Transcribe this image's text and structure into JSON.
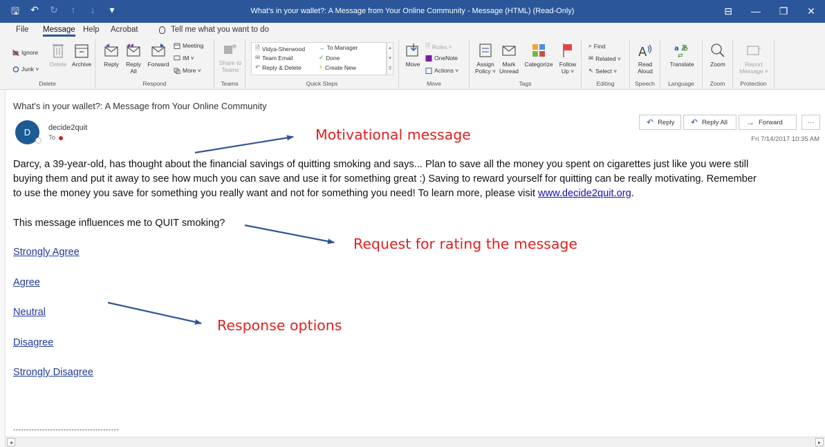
{
  "window": {
    "title": "What's in your wallet?: A Message from Your Online Community  -  Message (HTML) (Read-Only)",
    "controls": [
      "⊟",
      "—",
      "❐",
      "✕"
    ]
  },
  "qat": [
    "🖫",
    "↶",
    "↻",
    "↑",
    "↓",
    "▾"
  ],
  "menu": {
    "tabs": [
      "File",
      "Message",
      "Help",
      "Acrobat"
    ],
    "active_tab": "Message",
    "tell_me": "Tell me what you want to do"
  },
  "ribbon": {
    "delete_group": {
      "ignore": "Ignore",
      "junk": "Junk ˅",
      "delete": "Delete",
      "archive": "Archive",
      "label": "Delete"
    },
    "respond_group": {
      "reply": "Reply",
      "reply_all_1": "Reply",
      "reply_all_2": "All",
      "forward": "Forward",
      "meeting": "Meeting",
      "im": "IM ˅",
      "more": "More ˅",
      "label": "Respond"
    },
    "teams_group": {
      "share1": "Share to",
      "share2": "Teams",
      "label": "Teams"
    },
    "quick_steps": {
      "items": [
        "Vidya-Sherwood",
        "Team Email",
        "Reply & Delete",
        "To Manager",
        "Done",
        "Create New"
      ],
      "label": "Quick Steps"
    },
    "move_group": {
      "move": "Move",
      "rules": "Rules ˅",
      "onenote": "OneNote",
      "actions": "Actions ˅",
      "label": "Move"
    },
    "tags_group": {
      "assign1": "Assign",
      "assign2": "Policy ˅",
      "mark1": "Mark",
      "mark2": "Unread",
      "categorize": "Categorize",
      "follow1": "Follow",
      "follow2": "Up ˅",
      "label": "Tags"
    },
    "editing_group": {
      "find": "Find",
      "related": "Related ˅",
      "select": "Select ˅",
      "label": "Editing"
    },
    "speech_group": {
      "read1": "Read",
      "read2": "Aloud",
      "label": "Speech"
    },
    "language_group": {
      "translate": "Translate",
      "label": "Language"
    },
    "zoom_group": {
      "zoom": "Zoom",
      "label": "Zoom"
    },
    "protection_group": {
      "report1": "Report",
      "report2": "Message ˅",
      "label": "Protection"
    }
  },
  "message": {
    "subject": "What's in your wallet?: A Message from Your Online Community",
    "avatar_initial": "D",
    "sender": "decide2quit",
    "to_label": "To",
    "date": "Fri 7/14/2017 10:35 AM",
    "reply": "Reply",
    "reply_all": "Reply All",
    "forward": "Forward",
    "more": "···",
    "body_line1": "Darcy, a 39-year-old, has thought about the financial savings of quitting smoking and says... Plan to save all the money you spent on cigarettes just like you were still",
    "body_line2": "buying them and put it away to see how much you can save and use it for something great :) Saving to reward yourself for quitting can be really motivating. Remember",
    "body_line3": "to use the money you save for something you really want and not for something you need! To learn more, please visit ",
    "link": "www.decide2quit.org",
    "link_after": ".",
    "question": "This message influences me to QUIT smoking?",
    "options": [
      "Strongly Agree",
      "Agree",
      "Neutral",
      "Disagree",
      "Strongly Disagree"
    ],
    "footer_dashes": "----------------------------------------"
  },
  "annotations": {
    "motivational": "Motivational message",
    "request": "Request for rating the message",
    "responses": "Response options",
    "color": "#e02020",
    "arrow_color": "#2f5597"
  }
}
